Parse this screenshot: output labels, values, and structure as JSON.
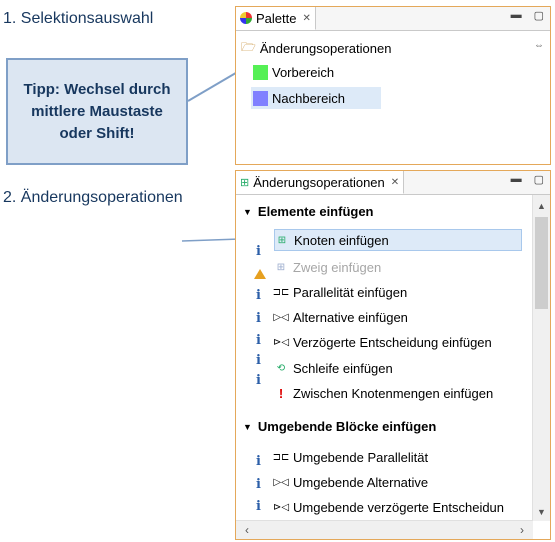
{
  "annotations": {
    "heading1": "1. Selektionsauswahl",
    "heading2": "2. Änderungsoperationen",
    "tip": "Tipp: Wechsel durch mittlere Maustaste oder Shift!"
  },
  "palette": {
    "tab_label": "Palette",
    "drawer_title": "Änderungsoperationen",
    "items": [
      {
        "label": "Vorbereich",
        "color": "#55f055"
      },
      {
        "label": "Nachbereich",
        "color": "#8080ff"
      }
    ]
  },
  "operations": {
    "tab_label": "Änderungsoperationen",
    "section1": {
      "title": "Elemente einfügen",
      "items": [
        {
          "label": "Knoten einfügen",
          "icon": "node-icon",
          "state": "selected"
        },
        {
          "label": "Zweig einfügen",
          "icon": "branch-icon",
          "state": "disabled"
        },
        {
          "label": "Parallelität einfügen",
          "icon": "parallel-icon"
        },
        {
          "label": "Alternative einfügen",
          "icon": "alternative-icon"
        },
        {
          "label": "Verzögerte Entscheidung einfügen",
          "icon": "deferred-icon"
        },
        {
          "label": "Schleife einfügen",
          "icon": "loop-icon"
        },
        {
          "label": "Zwischen Knotenmengen einfügen",
          "icon": "exclamation-icon"
        }
      ]
    },
    "section2": {
      "title": "Umgebende Blöcke einfügen",
      "items": [
        {
          "label": "Umgebende Parallelität",
          "icon": "parallel-icon"
        },
        {
          "label": "Umgebende Alternative",
          "icon": "alternative-icon"
        },
        {
          "label": "Umgebende verzögerte Entscheidun",
          "icon": "deferred-icon"
        }
      ]
    }
  }
}
